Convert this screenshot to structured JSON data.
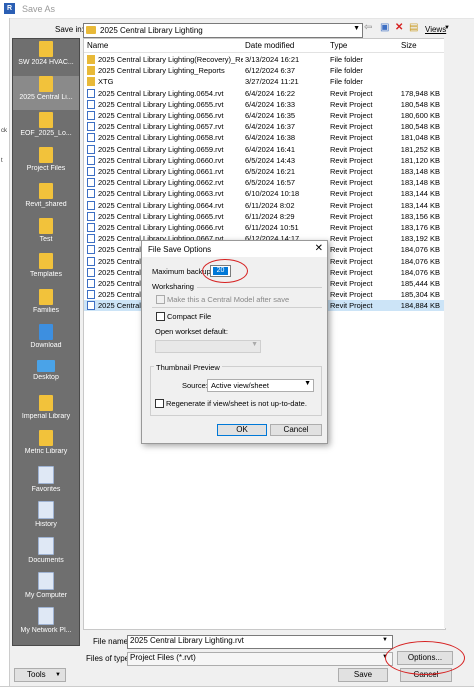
{
  "window": {
    "title": "Save As"
  },
  "toolbar": {
    "save_in_label": "Save in:",
    "save_in_value": "2025 Central Library Lighting",
    "views_label": "Views"
  },
  "places": [
    {
      "label": "SW 2024 HVAC..."
    },
    {
      "label": "2025 Central Li..."
    },
    {
      "label": "EOF_2025_Lo..."
    },
    {
      "label": "Project Files"
    },
    {
      "label": "Revit_shared"
    },
    {
      "label": "Test"
    },
    {
      "label": "Templates"
    },
    {
      "label": "Families"
    },
    {
      "label": "Download"
    },
    {
      "label": "Desktop"
    },
    {
      "label": "Imperial Library"
    },
    {
      "label": "Metric Library"
    },
    {
      "label": "Favorites"
    },
    {
      "label": "History"
    },
    {
      "label": "Documents"
    },
    {
      "label": "My Computer"
    },
    {
      "label": "My Network Pl..."
    }
  ],
  "columns": {
    "name": "Name",
    "date": "Date modified",
    "type": "Type",
    "size": "Size"
  },
  "files": [
    {
      "name": "2025 Central Library Lighting(Recovery)_Rep...",
      "date": "3/13/2024 16:21",
      "type": "File folder",
      "size": "",
      "kind": "folder"
    },
    {
      "name": "2025 Central Library Lighting_Reports",
      "date": "6/12/2024 6:37",
      "type": "File folder",
      "size": "",
      "kind": "folder"
    },
    {
      "name": "XTG",
      "date": "3/27/2024 11:21",
      "type": "File folder",
      "size": "",
      "kind": "folder"
    },
    {
      "name": "2025 Central Library Lighting.0654.rvt",
      "date": "6/4/2024 16:22",
      "type": "Revit Project",
      "size": "178,948 KB",
      "kind": "rvt"
    },
    {
      "name": "2025 Central Library Lighting.0655.rvt",
      "date": "6/4/2024 16:33",
      "type": "Revit Project",
      "size": "180,548 KB",
      "kind": "rvt"
    },
    {
      "name": "2025 Central Library Lighting.0656.rvt",
      "date": "6/4/2024 16:35",
      "type": "Revit Project",
      "size": "180,600 KB",
      "kind": "rvt"
    },
    {
      "name": "2025 Central Library Lighting.0657.rvt",
      "date": "6/4/2024 16:37",
      "type": "Revit Project",
      "size": "180,548 KB",
      "kind": "rvt"
    },
    {
      "name": "2025 Central Library Lighting.0658.rvt",
      "date": "6/4/2024 16:38",
      "type": "Revit Project",
      "size": "181,048 KB",
      "kind": "rvt"
    },
    {
      "name": "2025 Central Library Lighting.0659.rvt",
      "date": "6/4/2024 16:41",
      "type": "Revit Project",
      "size": "181,252 KB",
      "kind": "rvt"
    },
    {
      "name": "2025 Central Library Lighting.0660.rvt",
      "date": "6/5/2024 14:43",
      "type": "Revit Project",
      "size": "181,120 KB",
      "kind": "rvt"
    },
    {
      "name": "2025 Central Library Lighting.0661.rvt",
      "date": "6/5/2024 16:21",
      "type": "Revit Project",
      "size": "183,148 KB",
      "kind": "rvt"
    },
    {
      "name": "2025 Central Library Lighting.0662.rvt",
      "date": "6/5/2024 16:57",
      "type": "Revit Project",
      "size": "183,148 KB",
      "kind": "rvt"
    },
    {
      "name": "2025 Central Library Lighting.0663.rvt",
      "date": "6/10/2024 10:18",
      "type": "Revit Project",
      "size": "183,144 KB",
      "kind": "rvt"
    },
    {
      "name": "2025 Central Library Lighting.0664.rvt",
      "date": "6/11/2024 8:02",
      "type": "Revit Project",
      "size": "183,144 KB",
      "kind": "rvt"
    },
    {
      "name": "2025 Central Library Lighting.0665.rvt",
      "date": "6/11/2024 8:29",
      "type": "Revit Project",
      "size": "183,156 KB",
      "kind": "rvt"
    },
    {
      "name": "2025 Central Library Lighting.0666.rvt",
      "date": "6/11/2024 10:51",
      "type": "Revit Project",
      "size": "183,176 KB",
      "kind": "rvt"
    },
    {
      "name": "2025 Central Library Lighting.0667.rvt",
      "date": "6/12/2024 14:17",
      "type": "Revit Project",
      "size": "183,192 KB",
      "kind": "rvt"
    },
    {
      "name": "2025 Central Library Lighting.0668.rvt",
      "date": "",
      "type": "Revit Project",
      "size": "184,076 KB",
      "kind": "rvt"
    },
    {
      "name": "2025 Central Library Lighting.0669.rvt",
      "date": "",
      "type": "Revit Project",
      "size": "184,076 KB",
      "kind": "rvt"
    },
    {
      "name": "2025 Central Library Lighting.0670.rvt",
      "date": "",
      "type": "Revit Project",
      "size": "184,076 KB",
      "kind": "rvt"
    },
    {
      "name": "2025 Central Library Lighting.0671.rvt",
      "date": "",
      "type": "Revit Project",
      "size": "185,444 KB",
      "kind": "rvt"
    },
    {
      "name": "2025 Central Library Lighting.0672.rvt",
      "date": "",
      "type": "Revit Project",
      "size": "185,304 KB",
      "kind": "rvt"
    },
    {
      "name": "2025 Central Library Lighting.rvt",
      "date": "",
      "type": "Revit Project",
      "size": "184,884 KB",
      "kind": "rvt",
      "selected": true
    }
  ],
  "bottom": {
    "file_name_label": "File name:",
    "file_name_value": "2025 Central Library Lighting.rvt",
    "file_type_label": "Files of type:",
    "file_type_value": "Project Files  (*.rvt)",
    "tools_label": "Tools",
    "options_label": "Options...",
    "save_label": "Save",
    "cancel_label": "Cancel"
  },
  "modal": {
    "title": "File Save Options",
    "max_backups_label": "Maximum backups:",
    "max_backups_value": "20",
    "worksharing_label": "Worksharing",
    "make_central_label": "Make this a Central Model after save",
    "compact_label": "Compact File",
    "open_workset_label": "Open workset default:",
    "thumbnail_label": "Thumbnail Preview",
    "source_label": "Source:",
    "source_value": "Active view/sheet",
    "regenerate_label": "Regenerate if view/sheet is not up-to-date.",
    "ok_label": "OK",
    "cancel_label": "Cancel"
  },
  "colors": {
    "annotation": "#d62020",
    "selection": "#cce4f7",
    "accent": "#0078d7"
  }
}
